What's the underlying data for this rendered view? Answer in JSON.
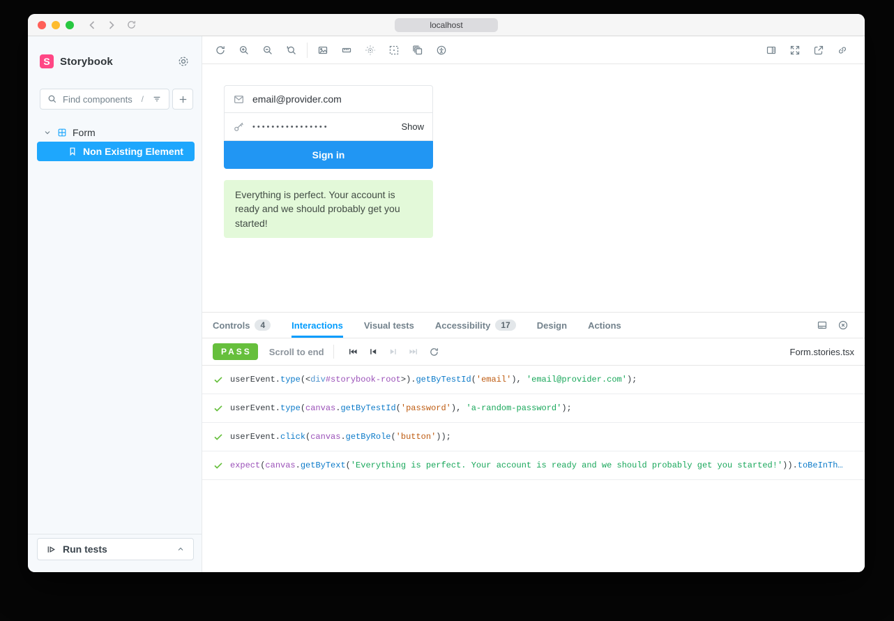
{
  "browser": {
    "url": "localhost"
  },
  "colors": {
    "accent": "#029CFD",
    "selection_blue": "#1EA7FD",
    "brand_pink": "#FF4785",
    "signin_button_blue": "#2196F3",
    "pass_green": "#66BF3C",
    "success_bg": "#E3F9D9",
    "sidebar_bg": "#F6F9FC"
  },
  "sidebar": {
    "logo_letter": "S",
    "brand": "Storybook",
    "search": {
      "placeholder": "Find components",
      "shortcut": "/"
    },
    "tree": {
      "group_label": "Form",
      "story_label": "Non Existing Element"
    },
    "run_tests_label": "Run tests"
  },
  "toolbar": {
    "left_icons": [
      "remount-icon",
      "zoom-in-icon",
      "zoom-out-icon",
      "zoom-reset-icon",
      "background-icon",
      "measure-icon",
      "grid-icon",
      "outline-icon",
      "viewport-icon",
      "vision-simulator-icon"
    ],
    "right_icons": [
      "panel-toggle-icon",
      "fullscreen-icon",
      "open-new-tab-icon",
      "copy-link-icon"
    ]
  },
  "preview": {
    "email_value": "email@provider.com",
    "password_masked": "••••••••••••••••",
    "show_label": "Show",
    "signin_label": "Sign in",
    "success_message": "Everything is perfect. Your account is ready and we should probably get you started!"
  },
  "panel": {
    "tabs": [
      {
        "label": "Controls",
        "badge": "4",
        "active": false
      },
      {
        "label": "Interactions",
        "active": true
      },
      {
        "label": "Visual tests",
        "active": false
      },
      {
        "label": "Accessibility",
        "badge": "17",
        "active": false
      },
      {
        "label": "Design",
        "active": false
      },
      {
        "label": "Actions",
        "active": false
      }
    ],
    "right_icons": [
      "panel-position-icon",
      "close-panel-icon"
    ],
    "interactions": {
      "status": "PASS",
      "scroll_label": "Scroll to end",
      "file": "Form.stories.tsx",
      "playback": [
        "go-to-start",
        "go-back",
        "go-forward",
        "go-to-end",
        "rerun"
      ],
      "rows": [
        {
          "tokens": [
            {
              "t": "userEvent.",
              "c": "plain"
            },
            {
              "t": "type",
              "c": "method"
            },
            {
              "t": "(<",
              "c": "plain"
            },
            {
              "t": "div",
              "c": "tag"
            },
            {
              "t": "#storybook-root",
              "c": "object"
            },
            {
              "t": ">).",
              "c": "plain"
            },
            {
              "t": "getByTestId",
              "c": "method"
            },
            {
              "t": "(",
              "c": "plain"
            },
            {
              "t": "'email'",
              "c": "str"
            },
            {
              "t": "), ",
              "c": "plain"
            },
            {
              "t": "'email@provider.com'",
              "c": "val"
            },
            {
              "t": ");",
              "c": "plain"
            }
          ]
        },
        {
          "tokens": [
            {
              "t": "userEvent.",
              "c": "plain"
            },
            {
              "t": "type",
              "c": "method"
            },
            {
              "t": "(",
              "c": "plain"
            },
            {
              "t": "canvas",
              "c": "object"
            },
            {
              "t": ".",
              "c": "plain"
            },
            {
              "t": "getByTestId",
              "c": "method"
            },
            {
              "t": "(",
              "c": "plain"
            },
            {
              "t": "'password'",
              "c": "str"
            },
            {
              "t": "), ",
              "c": "plain"
            },
            {
              "t": "'a-random-password'",
              "c": "val"
            },
            {
              "t": ");",
              "c": "plain"
            }
          ]
        },
        {
          "tokens": [
            {
              "t": "userEvent.",
              "c": "plain"
            },
            {
              "t": "click",
              "c": "method"
            },
            {
              "t": "(",
              "c": "plain"
            },
            {
              "t": "canvas",
              "c": "object"
            },
            {
              "t": ".",
              "c": "plain"
            },
            {
              "t": "getByRole",
              "c": "method"
            },
            {
              "t": "(",
              "c": "plain"
            },
            {
              "t": "'button'",
              "c": "str"
            },
            {
              "t": "));",
              "c": "plain"
            }
          ]
        },
        {
          "tokens": [
            {
              "t": "expect",
              "c": "object"
            },
            {
              "t": "(",
              "c": "plain"
            },
            {
              "t": "canvas",
              "c": "object"
            },
            {
              "t": ".",
              "c": "plain"
            },
            {
              "t": "getByText",
              "c": "method"
            },
            {
              "t": "(",
              "c": "plain"
            },
            {
              "t": "'Everything is perfect. Your account is ready and we should probably get you started!'",
              "c": "val"
            },
            {
              "t": ")).",
              "c": "plain"
            },
            {
              "t": "toBeInTh…",
              "c": "method"
            }
          ]
        }
      ]
    }
  }
}
